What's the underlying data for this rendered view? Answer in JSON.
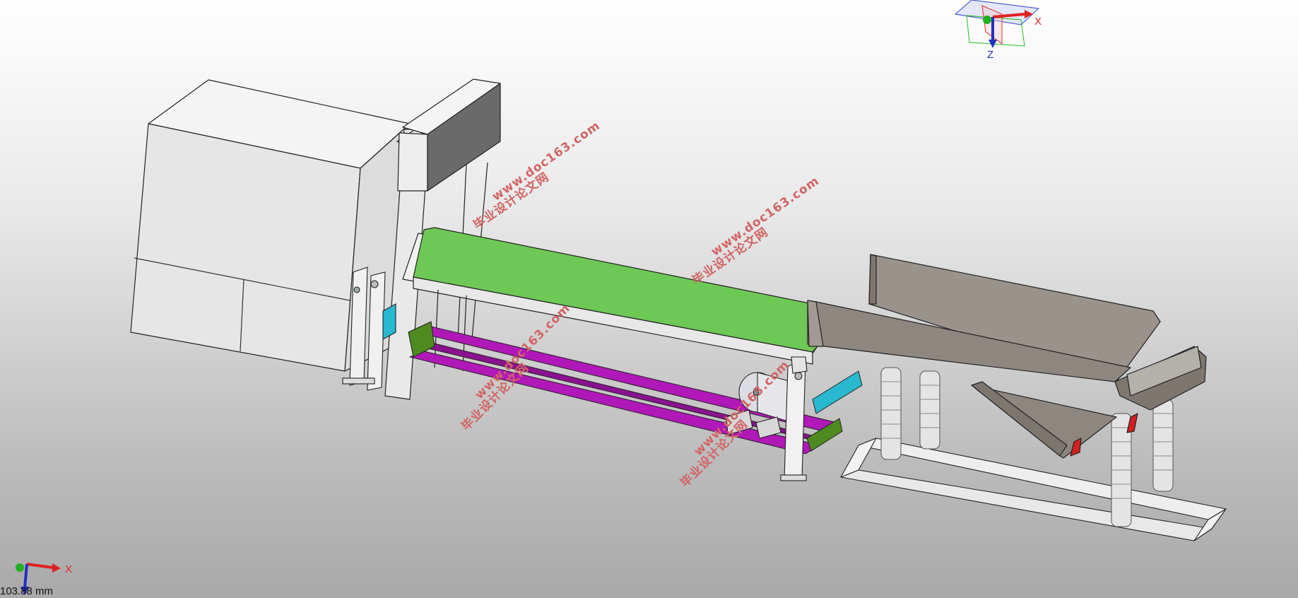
{
  "viewport": {
    "background_top": "#ffffff",
    "background_bottom": "#a9a9a9"
  },
  "triad_top": {
    "x_label": "X",
    "z_label": "Z",
    "x_color": "#e02020",
    "y_color": "#20b020",
    "z_color": "#2030c0"
  },
  "triad_corner": {
    "x_label": "X",
    "x_color": "#e02020",
    "y_color": "#20b020",
    "z_color": "#2030c0"
  },
  "scale_readout": "103.88 mm",
  "watermarks": [
    {
      "cn": "毕业设计论文网",
      "url": "www.doc163.com"
    },
    {
      "cn": "毕业设计论文网",
      "url": "www.doc163.com"
    },
    {
      "cn": "毕业设计论文网",
      "url": "www.doc163.com"
    },
    {
      "cn": "毕业设计论文网",
      "url": "www.doc163.com"
    }
  ],
  "model_colors": {
    "machine_body": "#ececec",
    "conveyor_belt": "#6ec855",
    "rails": "#b018b8",
    "feeder_tray": "#8e8780",
    "blue_bar": "#28b8d0",
    "green_bar": "#4f8a20"
  }
}
